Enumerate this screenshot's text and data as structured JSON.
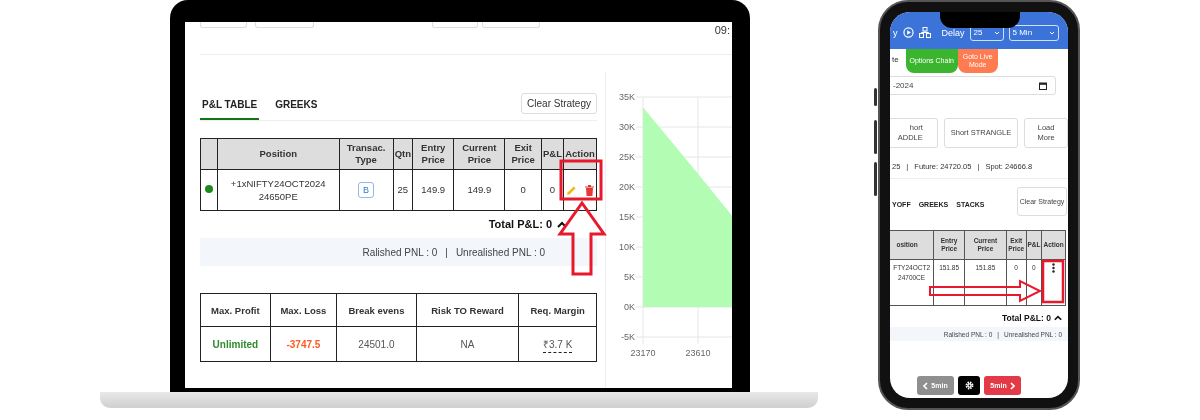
{
  "laptop": {
    "clock": "09:",
    "tabs": [
      {
        "label": "P&L TABLE",
        "selected": true
      },
      {
        "label": "GREEKS",
        "selected": false
      }
    ],
    "clear_button": "Clear Strategy",
    "positions": {
      "columns": [
        "Position",
        "Transac. Type",
        "Qtn",
        "Entry Price",
        "Current Price",
        "Exit Price",
        "P&L",
        "Action"
      ],
      "rows": [
        {
          "color": "#1e8a1e",
          "position": "+1xNIFTY24OCT2024 24650PE",
          "type": "B",
          "qtn": "25",
          "entry": "149.9",
          "current": "149.9",
          "exit": "0",
          "pnl": "0"
        }
      ]
    },
    "total_pnl": "Total P&L: 0",
    "expanded": true,
    "realised": "Ralished PNL : 0",
    "separator": "|",
    "unrealised": "Unrealished PNL : 0",
    "summary": {
      "columns": [
        "Max. Profit",
        "Max. Loss",
        "Break evens",
        "Risk TO Reward",
        "Req. Margin"
      ],
      "values": [
        {
          "text": "Unlimited",
          "color": "#2e8b2e"
        },
        {
          "text": "-3747.5",
          "color": "#ff5a1f"
        },
        {
          "text": "24501.0",
          "color": "#555555"
        },
        {
          "text": "NA",
          "color": "#555555"
        },
        {
          "text": "₹3.7 K",
          "color": "#555555"
        }
      ]
    },
    "chart_data": {
      "type": "area",
      "x": [
        23170,
        23610,
        23890
      ],
      "series": [
        {
          "color": "#b3fcb3",
          "values": [
            33300,
            22200,
            15000
          ]
        }
      ],
      "grid": true,
      "xlim": [
        23170,
        23890
      ],
      "ylim": [
        -5000,
        35000
      ],
      "xticks": [
        23170,
        23610
      ],
      "yticks": [
        {
          "value": 35000,
          "label": "35K"
        },
        {
          "value": 30000,
          "label": "30K"
        },
        {
          "value": 25000,
          "label": "25K"
        },
        {
          "value": 20000,
          "label": "20K"
        },
        {
          "value": 15000,
          "label": "15K"
        },
        {
          "value": 10000,
          "label": "10K"
        },
        {
          "value": 5000,
          "label": "5K"
        },
        {
          "value": 0,
          "label": "0K"
        },
        {
          "value": -5000,
          "label": "-5K"
        }
      ]
    }
  },
  "phone": {
    "header": {
      "title": "y",
      "delay_label": "Delay",
      "delay": "25",
      "interval": "5 Min"
    },
    "mode_label": "te",
    "mode_buttons": [
      {
        "label": "Options Chain",
        "color": "#3cb52e"
      },
      {
        "label": "Goto Live Mode",
        "color": "#ff7b50"
      }
    ],
    "date": "-2024",
    "strategies": [
      "hort ADDLE",
      "Short STRANGLE",
      "Load More"
    ],
    "info": [
      "25",
      "Future: 24720.05",
      "Spot: 24666.8"
    ],
    "separator": "|",
    "tabs": [
      {
        "label": "YOFF",
        "selected": false
      },
      {
        "label": "GREEKS",
        "selected": false
      },
      {
        "label": "STACKS",
        "selected": false
      }
    ],
    "clear_button": "Clear Strategy",
    "positions": {
      "columns": [
        "osition",
        "Entry Price",
        "Current Price",
        "Exit Price",
        "P&L",
        "Action"
      ],
      "rows": [
        {
          "position": "FTY24OCT2 24700CE",
          "entry": "151.85",
          "current": "151.85",
          "exit": "0",
          "pnl": "0"
        }
      ]
    },
    "total_pnl": "Total P&L: 0",
    "expanded": true,
    "realised": "Ralished PNL : 0",
    "unrealised": "Unrealished PNL : 0",
    "footer": [
      {
        "kind": "prev",
        "label": "5min",
        "disabled": true
      },
      {
        "kind": "settings"
      },
      {
        "kind": "next",
        "label": "5min",
        "disabled": false
      }
    ]
  }
}
